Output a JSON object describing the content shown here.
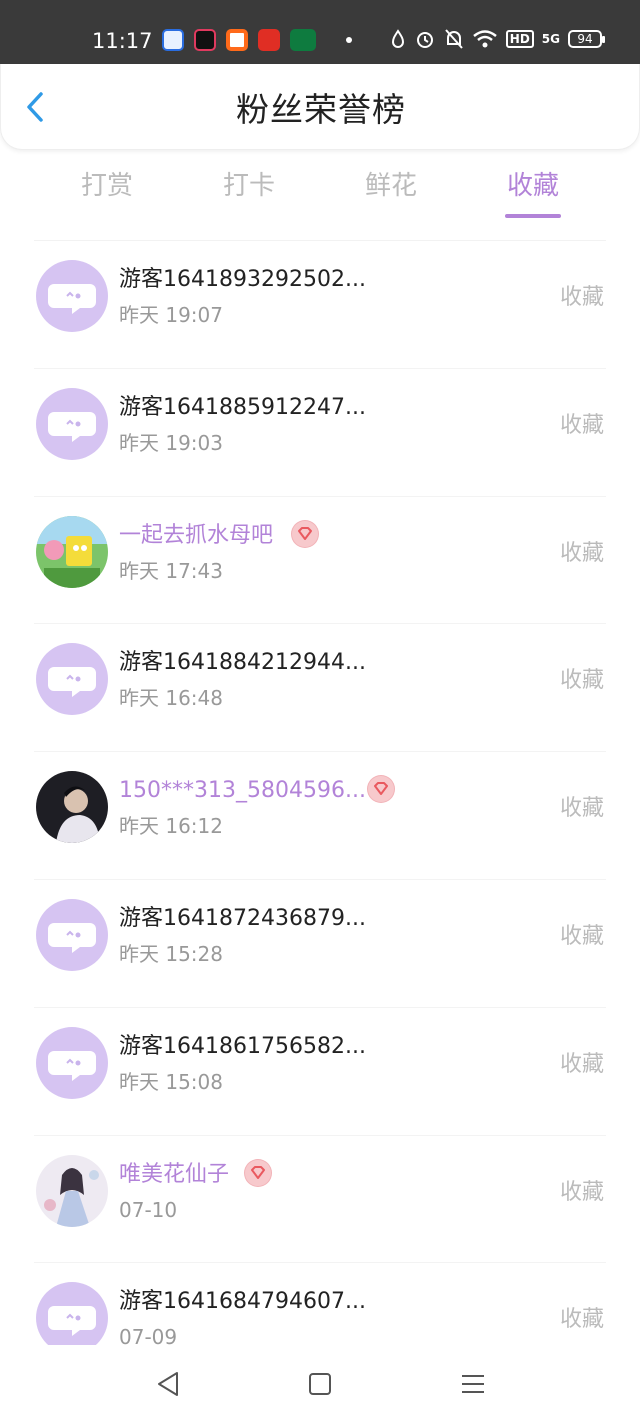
{
  "status_bar": {
    "time": "11:17",
    "battery": "94",
    "hd": "HD",
    "network": "5G"
  },
  "header": {
    "title": "粉丝荣誉榜"
  },
  "tabs": [
    {
      "label": "打赏",
      "active": false
    },
    {
      "label": "打卡",
      "active": false
    },
    {
      "label": "鲜花",
      "active": false
    },
    {
      "label": "收藏",
      "active": true
    }
  ],
  "rows": [
    {
      "name": "游客1641893292502...",
      "time": "昨天 19:07",
      "action": "收藏",
      "avatar": "default-chat-avatar",
      "vip": false
    },
    {
      "name": "游客1641885912247...",
      "time": "昨天 19:03",
      "action": "收藏",
      "avatar": "default-chat-avatar",
      "vip": false
    },
    {
      "name": "一起去抓水母吧",
      "time": "昨天 17:43",
      "action": "收藏",
      "avatar": "cartoon-photo-avatar",
      "vip": true
    },
    {
      "name": "游客1641884212944...",
      "time": "昨天 16:48",
      "action": "收藏",
      "avatar": "default-chat-avatar",
      "vip": false
    },
    {
      "name": "150***313_5804596...",
      "time": "昨天 16:12",
      "action": "收藏",
      "avatar": "dark-photo-avatar",
      "vip": true
    },
    {
      "name": "游客1641872436879...",
      "time": "昨天 15:28",
      "action": "收藏",
      "avatar": "default-chat-avatar",
      "vip": false
    },
    {
      "name": "游客1641861756582...",
      "time": "昨天 15:08",
      "action": "收藏",
      "avatar": "default-chat-avatar",
      "vip": false
    },
    {
      "name": "唯美花仙子",
      "time": "07-10",
      "action": "收藏",
      "avatar": "fairy-photo-avatar",
      "vip": true
    },
    {
      "name": "游客1641684794607...",
      "time": "07-09",
      "action": "收藏",
      "avatar": "default-chat-avatar",
      "vip": false
    }
  ],
  "colors": {
    "accent": "#b283d8",
    "default_avatar": "#d6c4f2",
    "badge": "#f2b3b8",
    "badge_icon": "#e9595f",
    "back_arrow": "#2f9ae6"
  }
}
